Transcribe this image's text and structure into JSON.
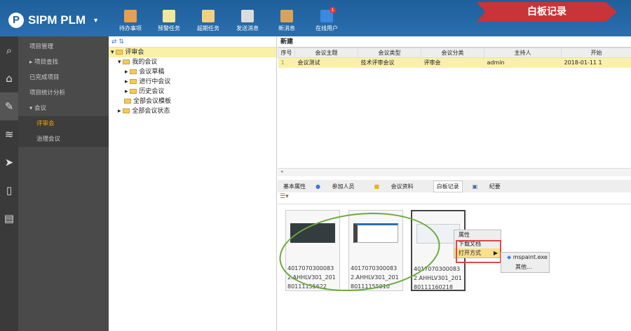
{
  "app": {
    "title": "SIPM PLM",
    "banner": "白板记录"
  },
  "toolbar": [
    {
      "label": "待办事项",
      "color": "#e8a04a"
    },
    {
      "label": "预警任务",
      "color": "#f2e6a0"
    },
    {
      "label": "超期任务",
      "color": "#f2d080"
    },
    {
      "label": "发送消息",
      "color": "#dcdcdc"
    },
    {
      "label": "新消息",
      "color": "#d9a45a"
    },
    {
      "label": "在线用户",
      "color": "#3a8ae0"
    }
  ],
  "online_badge": "1",
  "sidebar": {
    "items": [
      "项目管理",
      "项目查找",
      "已完成项目",
      "项目统计分析",
      "会议",
      "评审会",
      "治理会议"
    ]
  },
  "tree": {
    "nodes": [
      "评审会",
      "我的会议",
      "会议草稿",
      "进行中会议",
      "历史会议",
      "全部会议模板",
      "全部会议状态"
    ]
  },
  "grid": {
    "tab": "新建",
    "headers": [
      "序号",
      "会议主题",
      "会议类型",
      "会议分类",
      "主持人",
      "开始"
    ],
    "rows": [
      [
        "1",
        "会议测试",
        "技术评审会议",
        "评审会",
        "admin",
        "2018-01-11 1"
      ]
    ]
  },
  "detail_tabs": [
    "基本属性",
    "参加人员",
    "会议资料",
    "白板记录",
    "纪要"
  ],
  "thumbnails": [
    {
      "caption": "40170703000832.AHHLV301_20180111155622"
    },
    {
      "caption": "40170703000832.AHHLV301_20180111155910"
    },
    {
      "caption": "40170703000832.AHHLV301_20180111160218"
    }
  ],
  "context_menu": {
    "items": [
      "属性",
      "下载文档",
      "打开方式"
    ],
    "submenu": [
      "mspaint.exe",
      "其他..."
    ]
  }
}
